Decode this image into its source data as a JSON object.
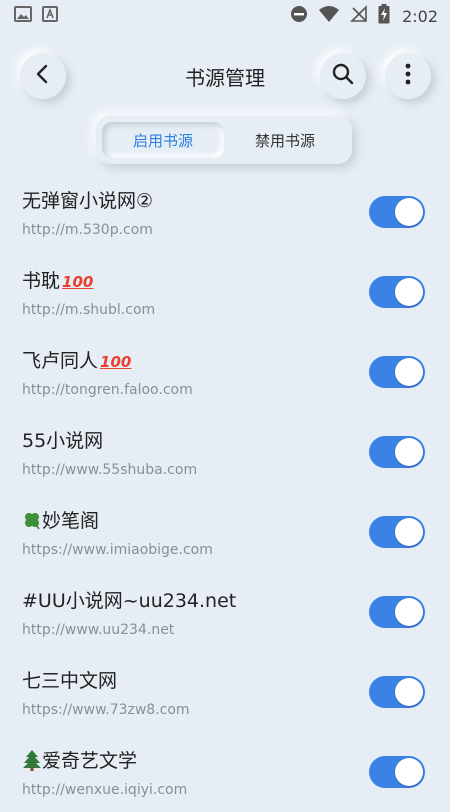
{
  "status_bar": {
    "time": "2:02",
    "left_icons": [
      "image-icon",
      "text-a-icon"
    ],
    "right_icons": [
      "do-not-disturb-icon",
      "wifi-icon",
      "no-sim-icon",
      "battery-charging-icon"
    ]
  },
  "header": {
    "title": "书源管理",
    "back_icon": "arrow-left-icon",
    "search_icon": "search-icon",
    "more_icon": "more-vertical-icon"
  },
  "tabs": [
    {
      "label": "启用书源",
      "active": true
    },
    {
      "label": "禁用书源",
      "active": false
    }
  ],
  "colors": {
    "background": "#e6edf5",
    "accent": "#2b7fe0",
    "toggle_on": "#3b82e6",
    "url_text": "#8a8f96"
  },
  "sources": [
    {
      "name": "无弹窗小说网②",
      "url": "http://m.530p.com",
      "enabled": true
    },
    {
      "name": "书耽",
      "badge": "100",
      "url": "http://m.shubl.com",
      "enabled": true
    },
    {
      "name": "飞卢同人",
      "badge": "100",
      "url": "http://tongren.faloo.com",
      "enabled": true
    },
    {
      "name": "55小说网",
      "url": "http://www.55shuba.com",
      "enabled": true
    },
    {
      "name": "妙笔阁",
      "prefix_icon": "clover-icon",
      "url": "https://www.imiaobige.com",
      "enabled": true
    },
    {
      "name": "#UU小说网~uu234.net",
      "url": "http://www.uu234.net",
      "enabled": true
    },
    {
      "name": "七三中文网",
      "url": "https://www.73zw8.com",
      "enabled": true
    },
    {
      "name": "爱奇艺文学",
      "prefix_icon": "tree-icon",
      "url": "http://wenxue.iqiyi.com",
      "enabled": true
    }
  ]
}
